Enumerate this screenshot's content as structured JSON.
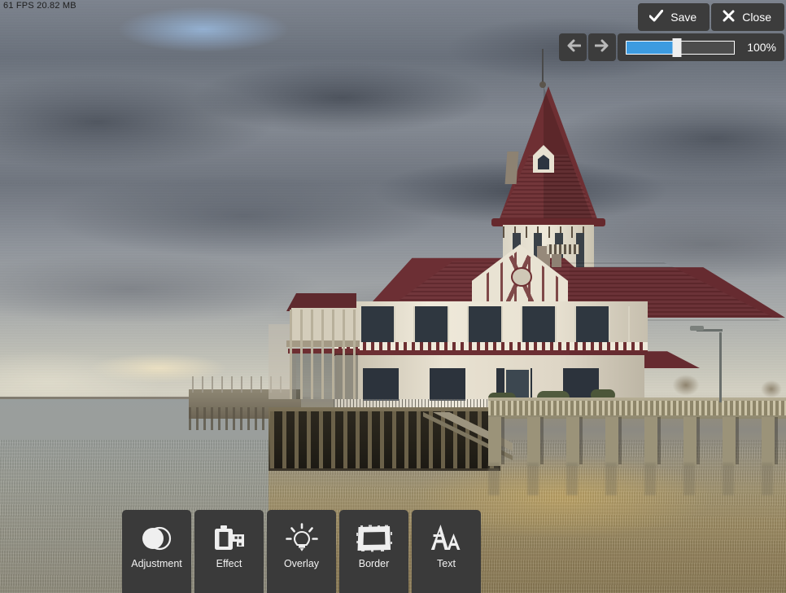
{
  "overlay": {
    "stats": "61 FPS 20.82 MB"
  },
  "topbar": {
    "save": {
      "label": "Save",
      "icon": "check-icon"
    },
    "close": {
      "label": "Close",
      "icon": "close-x-icon"
    }
  },
  "zoombar": {
    "back": {
      "icon": "arrow-left-icon"
    },
    "forward": {
      "icon": "arrow-right-icon"
    },
    "slider": {
      "value": 47,
      "min": 0,
      "max": 100
    },
    "zoom_label": "100%",
    "fill_color": "#3d9be0"
  },
  "tools": [
    {
      "label": "Adjustment",
      "icon": "contrast-circles-icon"
    },
    {
      "label": "Effect",
      "icon": "film-roll-icon"
    },
    {
      "label": "Overlay",
      "icon": "lightbulb-icon"
    },
    {
      "label": "Border",
      "icon": "picture-frame-icon"
    },
    {
      "label": "Text",
      "icon": "double-a-text-icon"
    }
  ],
  "photo": {
    "description": "HDR photograph of a Tudor-style pier building with a dark red spired tower over brown water under dramatic storm clouds",
    "colors": {
      "roof": "#6c2f34",
      "wall": "#e9e3d3",
      "water": "#9d8c63",
      "sky": "#7d848f",
      "pier": "#8e8774"
    }
  }
}
